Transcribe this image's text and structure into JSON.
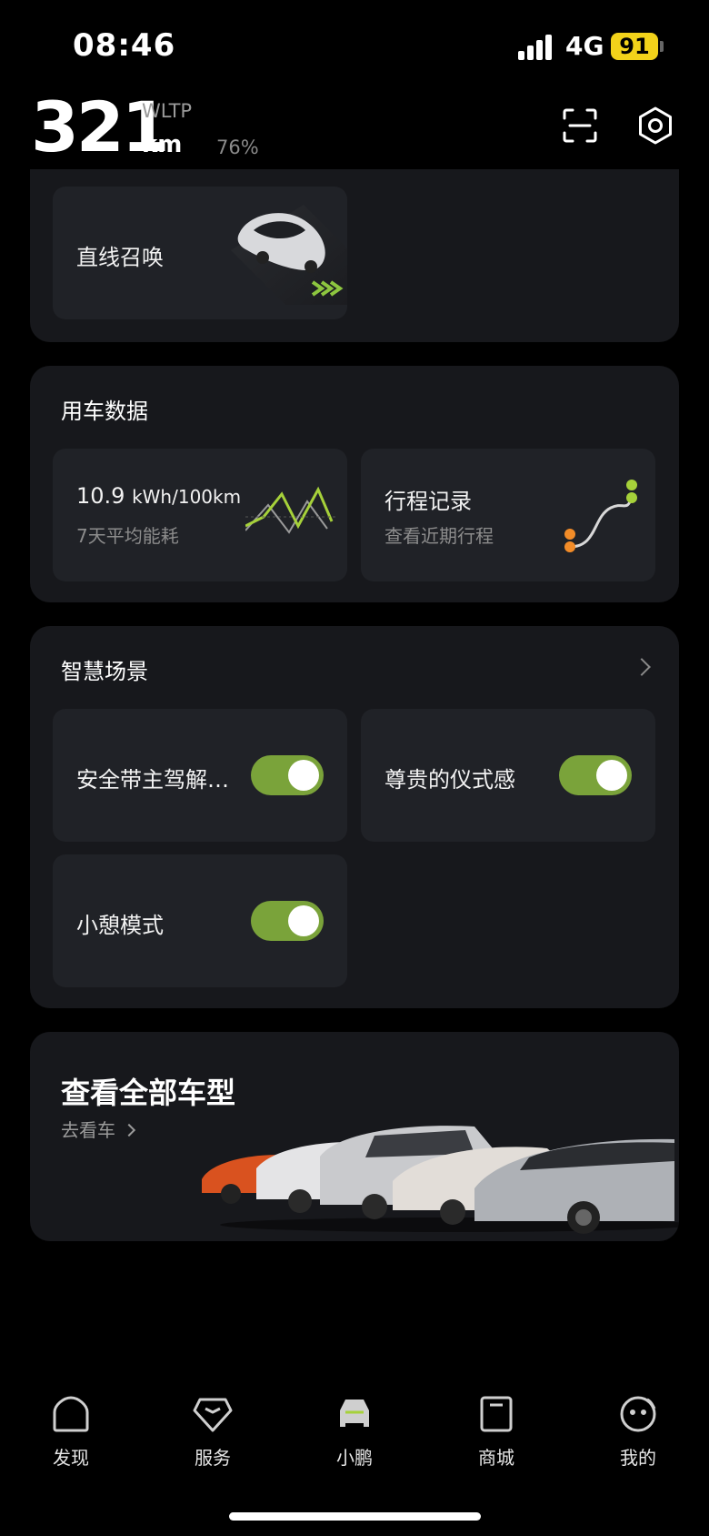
{
  "status": {
    "time": "08:46",
    "network": "4G",
    "battery": "91"
  },
  "header": {
    "range": "321",
    "standard": "WLTP",
    "unit": "km",
    "percent": "76%"
  },
  "summon": {
    "label": "直线召唤"
  },
  "usage": {
    "title": "用车数据",
    "energy": {
      "value": "10.9",
      "unit": "kWh/100km",
      "caption": "7天平均能耗"
    },
    "trips": {
      "title": "行程记录",
      "caption": "查看近期行程"
    }
  },
  "scenes": {
    "title": "智慧场景",
    "items": [
      {
        "label": "安全带主驾解…",
        "on": true
      },
      {
        "label": "尊贵的仪式感",
        "on": true
      },
      {
        "label": "小憩模式",
        "on": true
      }
    ]
  },
  "models": {
    "title": "查看全部车型",
    "link": "去看车"
  },
  "tabs": [
    {
      "label": "发现",
      "icon": "discover-icon"
    },
    {
      "label": "服务",
      "icon": "service-icon"
    },
    {
      "label": "小鹏",
      "icon": "car-icon"
    },
    {
      "label": "商城",
      "icon": "shop-icon"
    },
    {
      "label": "我的",
      "icon": "profile-icon"
    }
  ],
  "colors": {
    "accent": "#7aa33a",
    "battery": "#f2d21a",
    "card": "#17181c",
    "tile": "#202227"
  }
}
